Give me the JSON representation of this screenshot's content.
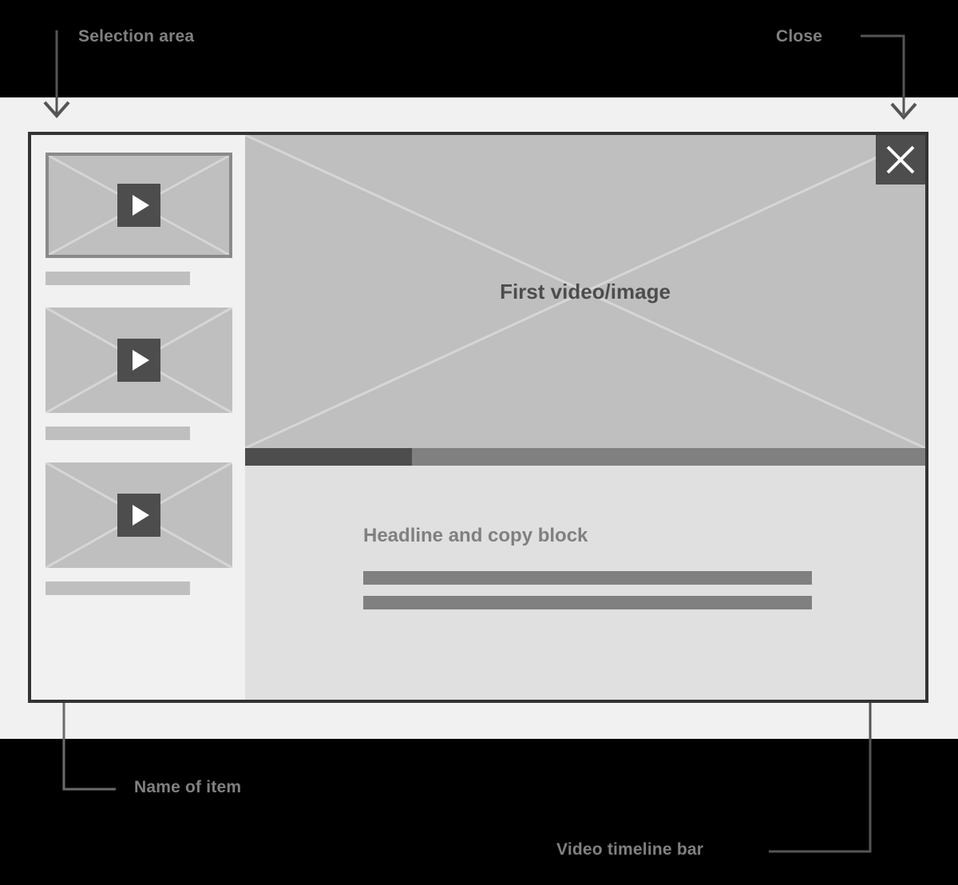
{
  "annotations": [
    {
      "id": "selection-area",
      "label": "Selection area"
    },
    {
      "id": "close",
      "label": "Close"
    },
    {
      "id": "name-of-item",
      "label": "Name of item"
    },
    {
      "id": "video-timeline-bar",
      "label": "Video timeline bar"
    }
  ],
  "modal": {
    "close_button": {
      "icon": "close-x-icon",
      "label": "Close"
    },
    "sidebar": {
      "items": [
        {
          "icon": "play-icon",
          "caption": "",
          "selected": true
        },
        {
          "icon": "play-icon",
          "caption": "",
          "selected": false
        },
        {
          "icon": "play-icon",
          "caption": "",
          "selected": false
        }
      ]
    },
    "hero": {
      "label": "First video/image",
      "placeholder_icon": "image-placeholder-cross-icon"
    },
    "timeline": {
      "progress_percent": 24.5,
      "progress_color": "#4d4d4d",
      "track_color": "#808080"
    },
    "copy": {
      "headline": "Headline and copy block",
      "lines": [
        "",
        ""
      ]
    }
  },
  "colors": {
    "backdrop": "#000000",
    "band": "#f1f1f1",
    "modal_border": "#333333",
    "sidebar_bg": "#f1f1f1",
    "main_bg": "#e0e0e0",
    "placeholder": "#bfbfbf",
    "dark_accent": "#4d4d4d",
    "mid_gray": "#808080",
    "anno_text": "#808080"
  }
}
